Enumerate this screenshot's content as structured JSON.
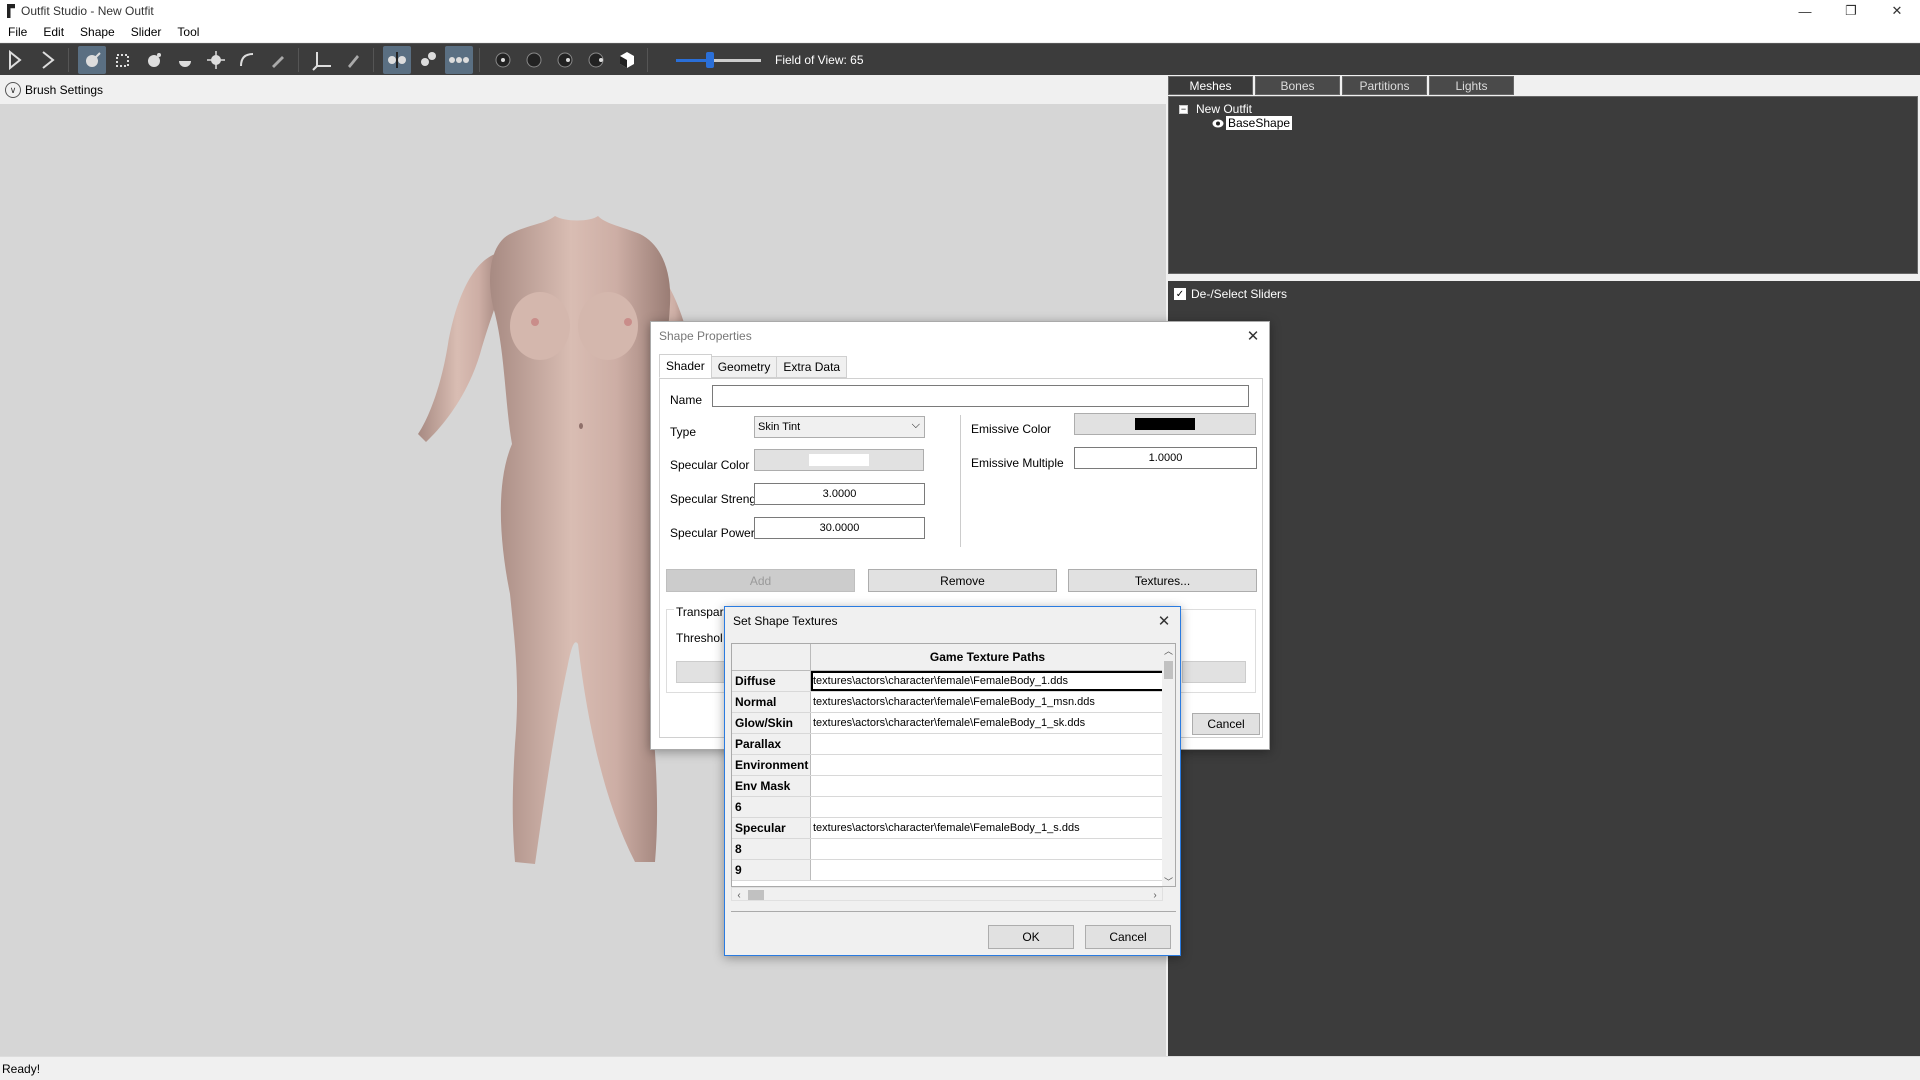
{
  "window": {
    "title": "Outfit Studio - New Outfit"
  },
  "menu": [
    "File",
    "Edit",
    "Shape",
    "Slider",
    "Tool"
  ],
  "toolbar": {
    "fov_label": "Field of View: 65",
    "fov_slider_fraction": 0.4
  },
  "brush_settings": {
    "label": "Brush Settings"
  },
  "right_panel": {
    "tabs": [
      "Meshes",
      "Bones",
      "Partitions",
      "Lights"
    ],
    "tree": {
      "root": "New Outfit",
      "expander": "−",
      "child": "BaseShape"
    },
    "sliders_checkbox_label": "De-/Select Sliders",
    "check_mark": "✓"
  },
  "status": {
    "text": "Ready!"
  },
  "shape_properties": {
    "title": "Shape Properties",
    "tabs": [
      "Shader",
      "Geometry",
      "Extra Data"
    ],
    "name_label": "Name",
    "name_value": "",
    "type_label": "Type",
    "type_value": "Skin Tint",
    "specular_color_label": "Specular Color",
    "specular_color": "#ffffff",
    "specular_strength_label": "Specular Strength",
    "specular_strength_value": "3.0000",
    "specular_power_label": "Specular Power",
    "specular_power_value": "30.0000",
    "emissive_color_label": "Emissive Color",
    "emissive_color": "#000000",
    "emissive_multiple_label": "Emissive Multiple",
    "emissive_multiple_value": "1.0000",
    "add_label": "Add",
    "remove_label": "Remove",
    "textures_label": "Textures...",
    "transparency_label": "Transpare",
    "threshold_label": "Threshol",
    "cancel_label": "Cancel"
  },
  "texture_dialog": {
    "title": "Set Shape Textures",
    "column_header": "Game Texture Paths",
    "rows": [
      {
        "label": "Diffuse",
        "path": "textures\\actors\\character\\female\\FemaleBody_1.dds"
      },
      {
        "label": "Normal",
        "path": "textures\\actors\\character\\female\\FemaleBody_1_msn.dds"
      },
      {
        "label": "Glow/Skin",
        "path": "textures\\actors\\character\\female\\FemaleBody_1_sk.dds"
      },
      {
        "label": "Parallax",
        "path": ""
      },
      {
        "label": "Environment",
        "path": ""
      },
      {
        "label": "Env Mask",
        "path": ""
      },
      {
        "label": "6",
        "path": ""
      },
      {
        "label": "Specular",
        "path": "textures\\actors\\character\\female\\FemaleBody_1_s.dds"
      },
      {
        "label": "8",
        "path": ""
      },
      {
        "label": "9",
        "path": ""
      }
    ],
    "ok_label": "OK",
    "cancel_label": "Cancel"
  }
}
